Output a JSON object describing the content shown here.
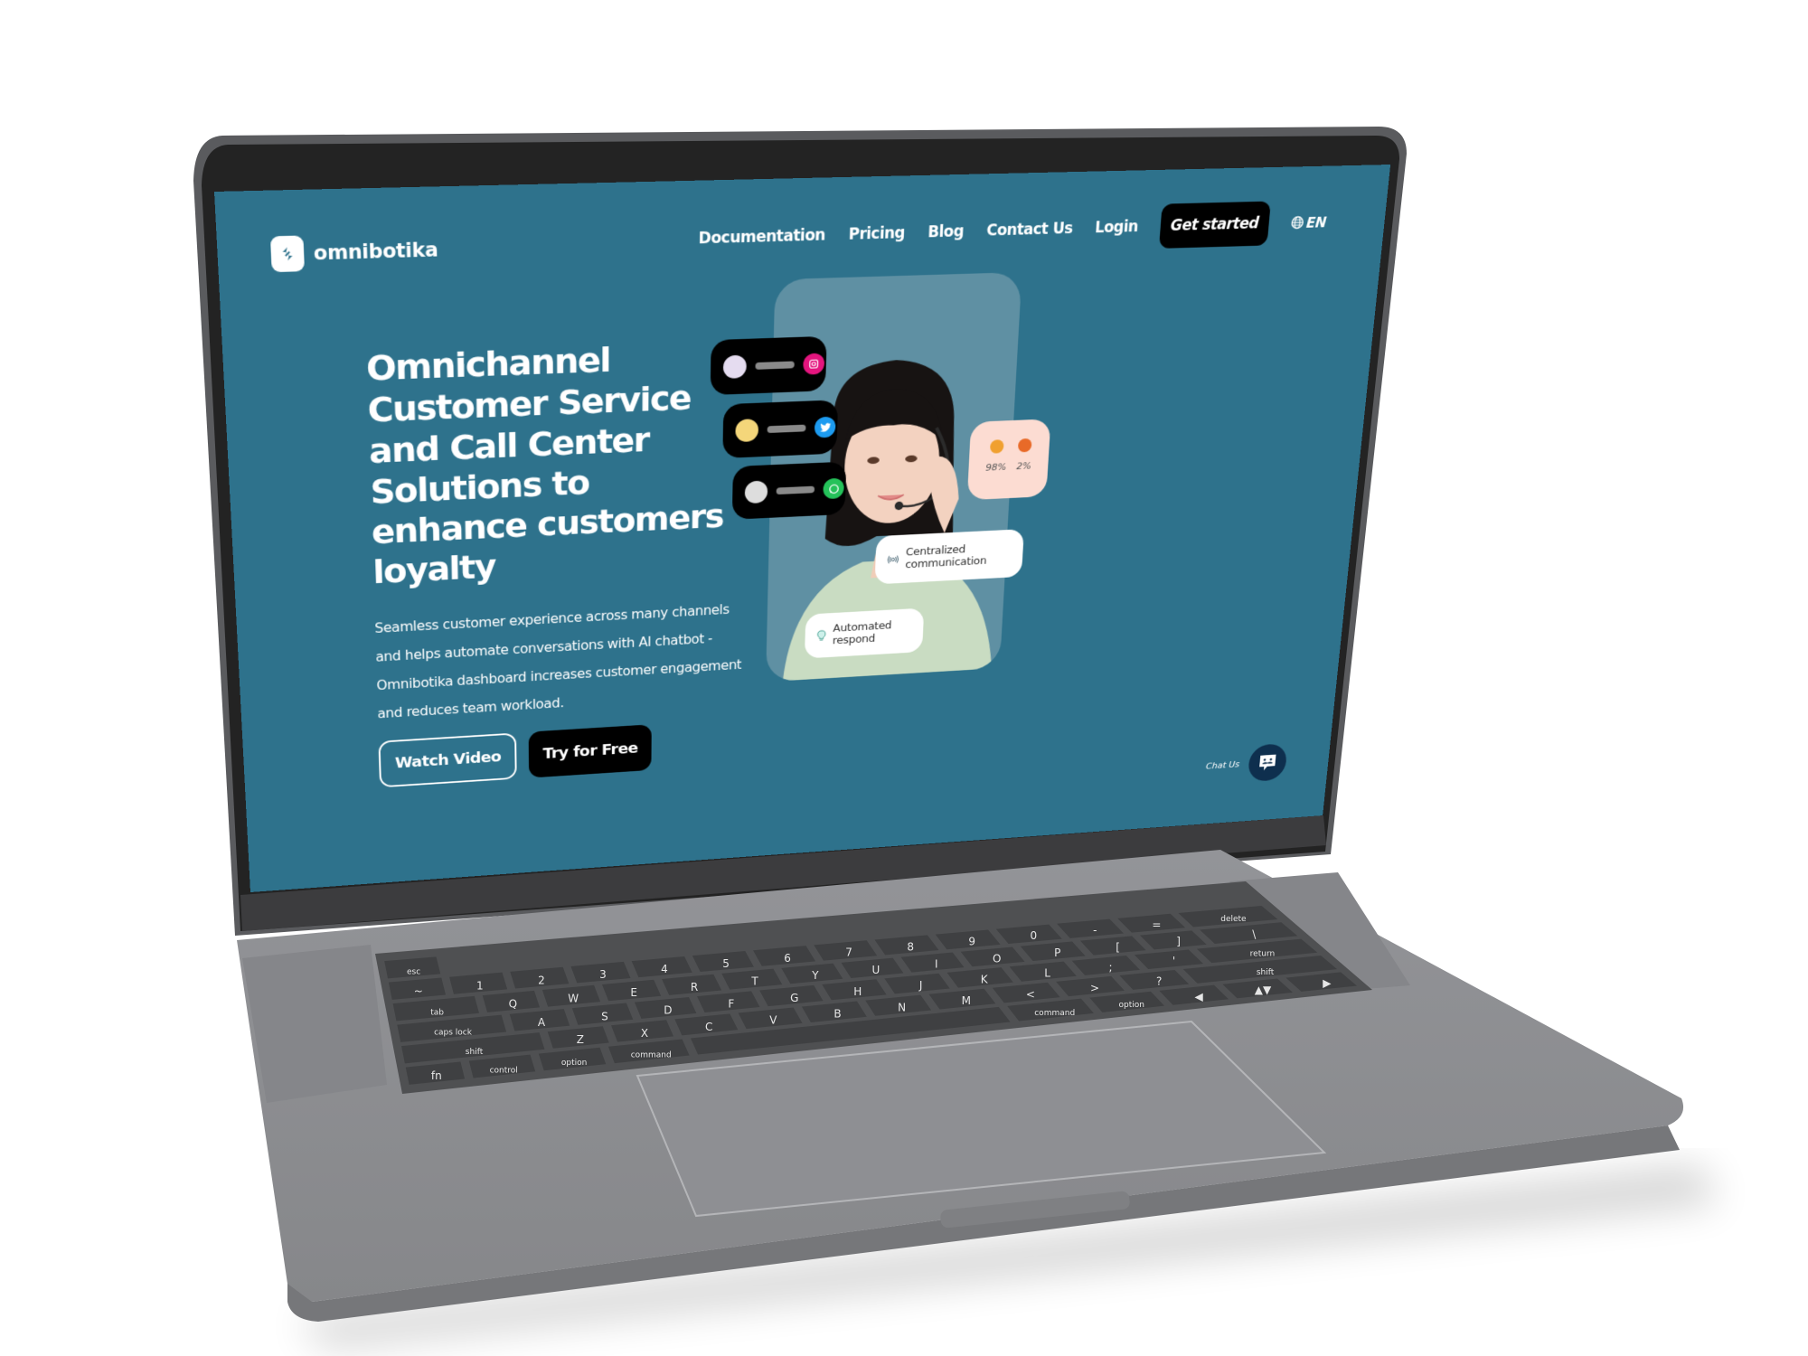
{
  "site": {
    "brand": "omnibotika",
    "nav": {
      "links": [
        "Documentation",
        "Pricing",
        "Blog",
        "Contact Us",
        "Login"
      ],
      "cta": "Get started",
      "language": "EN"
    },
    "hero": {
      "title": "Omnichannel Customer Service and Call Center Solutions to enhance customers loyalty",
      "description": "Seamless customer experience across many channels and helps automate conversations with AI chatbot - Omnibotika dashboard increases customer engagement and reduces team workload.",
      "buttons": {
        "secondary": "Watch Video",
        "primary": "Try for Free"
      }
    },
    "channels": [
      {
        "name": "instagram",
        "icon": "instagram-icon",
        "color": "#e4157e",
        "avatar_color": "#e5dcf0"
      },
      {
        "name": "twitter",
        "icon": "twitter-icon",
        "color": "#1d9bf0",
        "avatar_color": "#f4d67a"
      },
      {
        "name": "whatsapp",
        "icon": "whatsapp-icon",
        "color": "#25c25a",
        "avatar_color": "#dddddd"
      }
    ],
    "sentiment": [
      {
        "emoji": "heart-eyes-emoji",
        "value": "98%",
        "color": "#f0a030"
      },
      {
        "emoji": "angry-emoji",
        "value": "2%",
        "color": "#e86a28"
      }
    ],
    "features": [
      {
        "icon": "broadcast-icon",
        "label": "Centralized communication"
      },
      {
        "icon": "lightbulb-icon",
        "label": "Automated respond"
      }
    ],
    "chat": {
      "label": "Chat Us"
    }
  },
  "colors": {
    "background": "#2e728c",
    "panel": "#5f90a3",
    "button_dark": "#000000",
    "laptop_body": "#8c8d90",
    "bezel": "#222222"
  },
  "keyboard": {
    "rows": [
      [
        "esc"
      ],
      [
        "~",
        "1",
        "2",
        "3",
        "4",
        "5",
        "6",
        "7",
        "8",
        "9",
        "0",
        "-",
        "=",
        "delete"
      ],
      [
        "tab",
        "Q",
        "W",
        "E",
        "R",
        "T",
        "Y",
        "U",
        "I",
        "O",
        "P",
        "[",
        "]",
        "\\"
      ],
      [
        "caps lock",
        "A",
        "S",
        "D",
        "F",
        "G",
        "H",
        "J",
        "K",
        "L",
        ";",
        "'",
        "return"
      ],
      [
        "shift",
        "Z",
        "X",
        "C",
        "V",
        "B",
        "N",
        "M",
        "<",
        ">",
        "?",
        "shift"
      ],
      [
        "fn",
        "control",
        "option",
        "command",
        "",
        "command",
        "option",
        "◀",
        "▲▼",
        "▶"
      ]
    ]
  }
}
